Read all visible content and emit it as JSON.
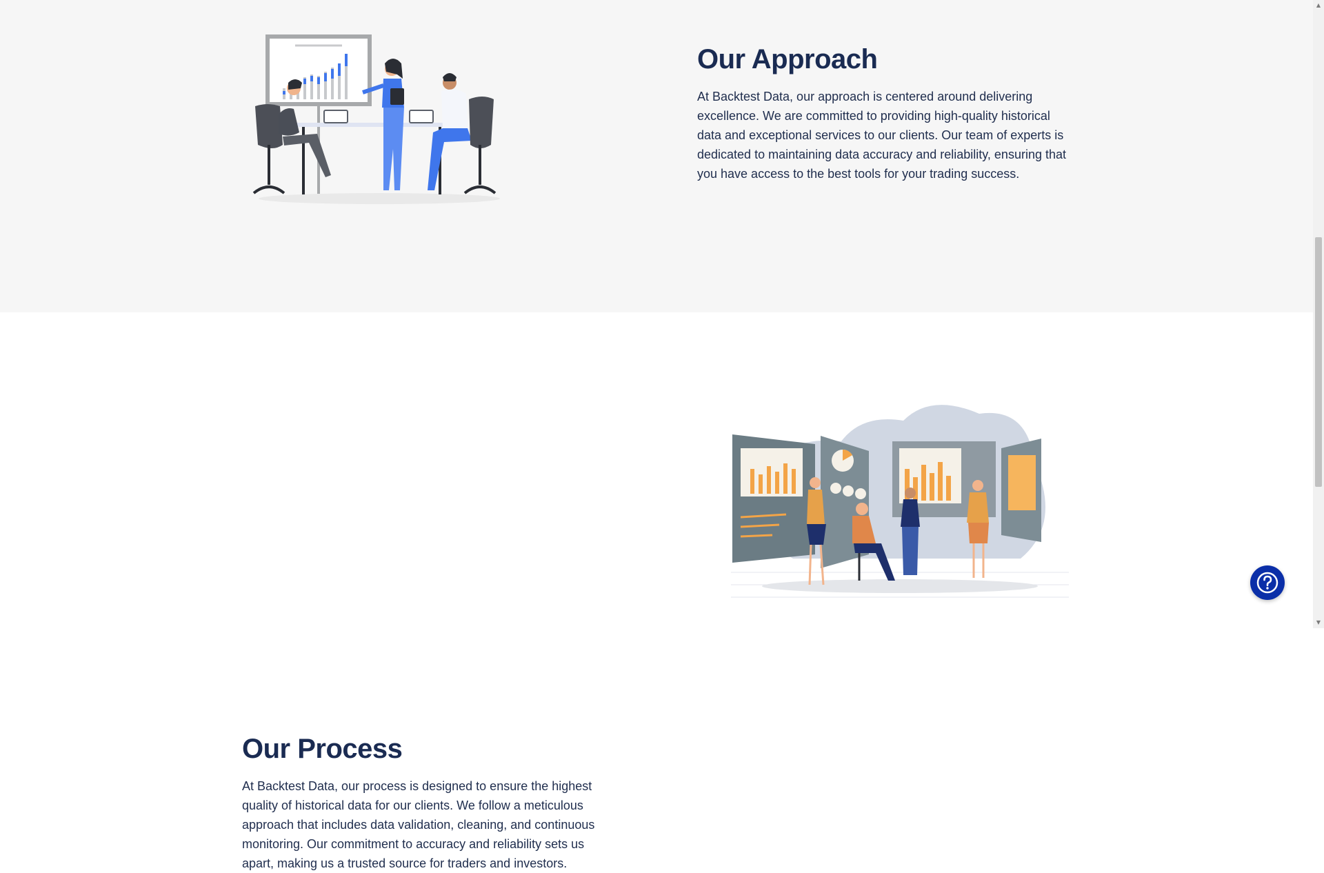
{
  "approach": {
    "title": "Our Approach",
    "text": "At Backtest Data, our approach is centered around delivering excellence. We are committed to providing high-quality historical data and exceptional services to our clients. Our team of experts is dedicated to maintaining data accuracy and reliability, ensuring that you have access to the best tools for your trading success.",
    "illustration_icon": "team-meeting-illustration"
  },
  "process": {
    "title": "Our Process",
    "text": "At Backtest Data, our process is designed to ensure the highest quality of historical data for our clients. We follow a meticulous approach that includes data validation, cleaning, and continuous monitoring. Our commitment to accuracy and reliability sets us apart, making us a trusted source for traders and investors.",
    "illustration_icon": "analytics-dashboard-illustration"
  },
  "help_widget": {
    "icon": "question-mark-icon"
  },
  "colors": {
    "heading": "#1a2b52",
    "body_text": "#1f2d4d",
    "approach_bg": "#f6f6f6",
    "accent_blue": "#3f76ec",
    "accent_orange": "#f3a447",
    "help_button": "#0b2fa8"
  }
}
